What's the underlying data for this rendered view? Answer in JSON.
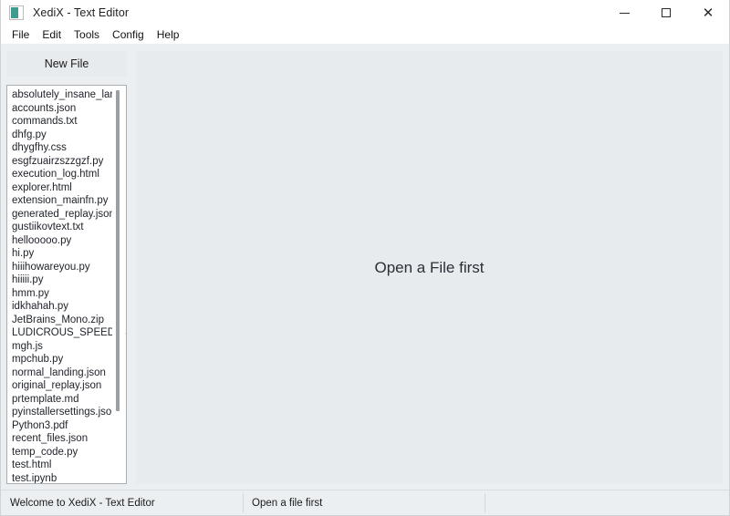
{
  "window": {
    "title": "XediX - Text Editor",
    "icon": "app-icon",
    "controls": {
      "minimize_label": "–",
      "maximize_label": "□",
      "close_label": "✕"
    }
  },
  "menubar": {
    "items": [
      {
        "label": "File"
      },
      {
        "label": "Edit"
      },
      {
        "label": "Tools"
      },
      {
        "label": "Config"
      },
      {
        "label": "Help"
      }
    ]
  },
  "sidebar": {
    "new_file_label": "New File",
    "files": [
      "absolutely_insane_land",
      "accounts.json",
      "commands.txt",
      "dhfg.py",
      "dhygfhy.css",
      "esgfzuairzszzgzf.py",
      "execution_log.html",
      "explorer.html",
      "extension_mainfn.py",
      "generated_replay.json",
      "gustiikovtext.txt",
      "hellooooo.py",
      "hi.py",
      "hiiihowareyou.py",
      "hiiiii.py",
      "hmm.py",
      "idkhahah.py",
      "JetBrains_Mono.zip",
      "LUDICROUS_SPEED.jsc",
      "mgh.js",
      "mpchub.py",
      "normal_landing.json",
      "original_replay.json",
      "prtemplate.md",
      "pyinstallersettings.json",
      "Python3.pdf",
      "recent_files.json",
      "temp_code.py",
      "test.html",
      "test.ipynb"
    ]
  },
  "editor": {
    "placeholder": "Open a File first"
  },
  "statusbar": {
    "left": "Welcome to XediX - Text Editor",
    "middle": "Open a file first",
    "right": ""
  },
  "colors": {
    "window_bg": "#eceff1",
    "panel_bg": "#e8ebee",
    "list_bg": "#ffffff",
    "accent": "#3f9b8e",
    "text": "#1b1b1b"
  }
}
